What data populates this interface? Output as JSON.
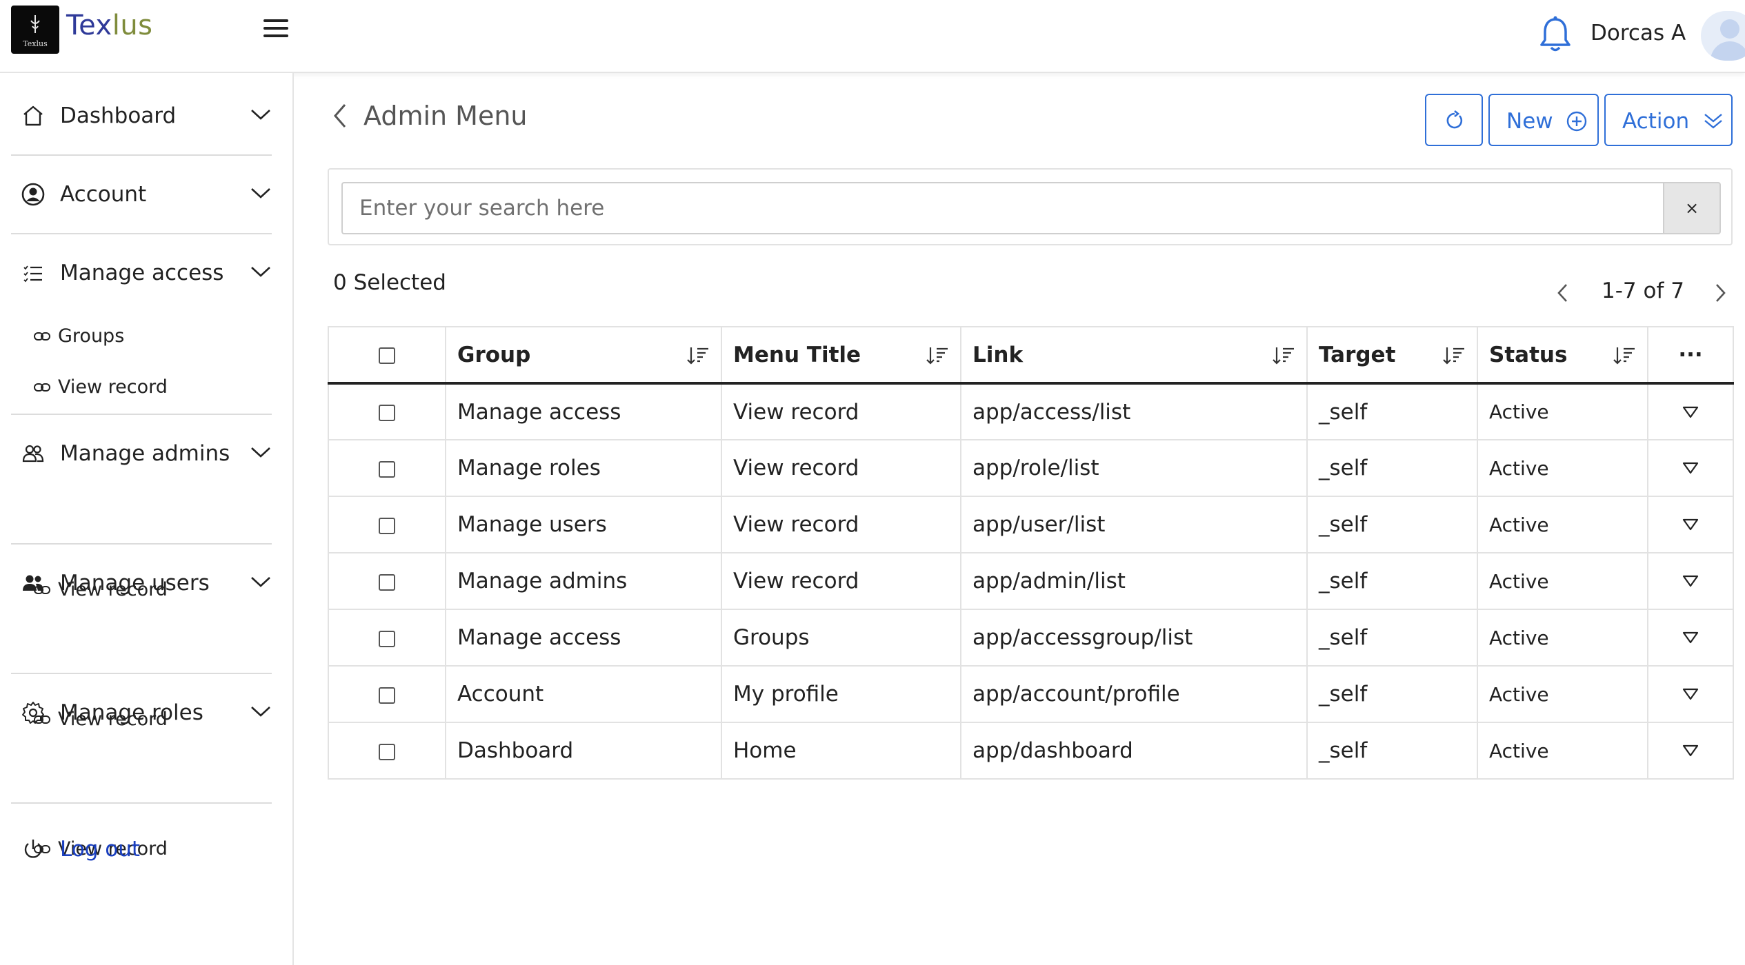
{
  "header": {
    "logo_mini_text": "Texlus",
    "brand_part1": "Tex",
    "brand_part2": "lus",
    "username": "Dorcas A"
  },
  "sidebar": {
    "items": [
      {
        "label": "Dashboard",
        "icon": "home-icon",
        "children": []
      },
      {
        "label": "Account",
        "icon": "user-circle-icon",
        "children": []
      },
      {
        "label": "Manage access",
        "icon": "list-icon",
        "children": [
          "Groups",
          "View record"
        ]
      },
      {
        "label": "Manage admins",
        "icon": "users-outline-icon",
        "children": [
          "View record"
        ]
      },
      {
        "label": "Manage users",
        "icon": "users-solid-icon",
        "children": [
          "View record"
        ]
      },
      {
        "label": "Manage roles",
        "icon": "gear-icon",
        "children": [
          "View record"
        ]
      }
    ],
    "logout_label": "Log out"
  },
  "page": {
    "title": "Admin Menu",
    "new_label": "New",
    "action_label": "Action",
    "search_placeholder": "Enter your search here",
    "clear_label": "×",
    "selected_text": "0 Selected",
    "pager_text": "1-7 of 7"
  },
  "table": {
    "columns": [
      "Group",
      "Menu Title",
      "Link",
      "Target",
      "Status"
    ],
    "more_label": "···",
    "rows": [
      {
        "group": "Manage access",
        "title": "View record",
        "link": "app/access/list",
        "target": "_self",
        "status": "Active"
      },
      {
        "group": "Manage roles",
        "title": "View record",
        "link": "app/role/list",
        "target": "_self",
        "status": "Active"
      },
      {
        "group": "Manage users",
        "title": "View record",
        "link": "app/user/list",
        "target": "_self",
        "status": "Active"
      },
      {
        "group": "Manage admins",
        "title": "View record",
        "link": "app/admin/list",
        "target": "_self",
        "status": "Active"
      },
      {
        "group": "Manage access",
        "title": "Groups",
        "link": "app/accessgroup/list",
        "target": "_self",
        "status": "Active"
      },
      {
        "group": "Account",
        "title": "My profile",
        "link": "app/account/profile",
        "target": "_self",
        "status": "Active"
      },
      {
        "group": "Dashboard",
        "title": "Home",
        "link": "app/dashboard",
        "target": "_self",
        "status": "Active"
      }
    ]
  },
  "colors": {
    "accent": "#2f6fd8",
    "logout": "#1a3fbf",
    "brand_primary": "#2f3a99",
    "brand_secondary": "#7f8c3c"
  }
}
